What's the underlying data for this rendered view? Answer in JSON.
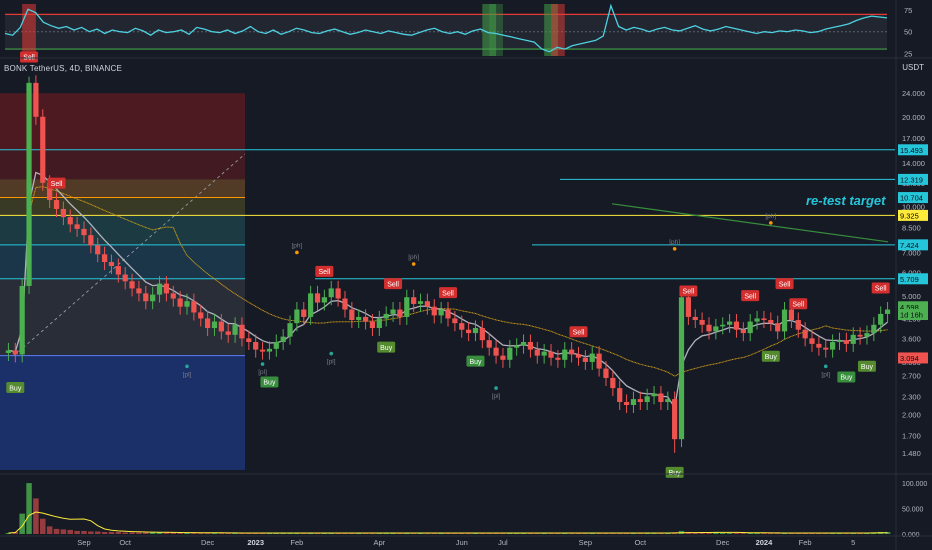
{
  "symbol_header": "BONK TetherUS, 4D, BINANCE",
  "currency": "USDT",
  "annotation": "re-test target",
  "colors": {
    "bg": "#161a25",
    "up": "#26a69a",
    "up_candle": "#4caf50",
    "down": "#ef5350",
    "ema": "#b0b3bd",
    "ma": "#d4a017",
    "cyan": "#26c6da",
    "yellow": "#ffeb3b",
    "orange": "#ff9800",
    "green_line": "#388e3c",
    "sell": "#d32f2f",
    "buy": "#388e3c",
    "buy_olive": "#558b2f",
    "rsi": "#4dd0e1",
    "label_blue": "#26c6da"
  },
  "chart_data": [
    {
      "type": "line",
      "name": "oscillator",
      "y_ticks": [
        75,
        50,
        25
      ],
      "ylim": [
        22,
        82
      ],
      "y": [
        48,
        46,
        55,
        76,
        72,
        61,
        57,
        54,
        56,
        52,
        55,
        50,
        53,
        48,
        52,
        50,
        49,
        54,
        51,
        46,
        52,
        49,
        50,
        52,
        47,
        55,
        53,
        50,
        49,
        52,
        48,
        51,
        56,
        50,
        48,
        52,
        47,
        50,
        54,
        52,
        49,
        48,
        51,
        53,
        50,
        47,
        49,
        52,
        50,
        48,
        51,
        49,
        47,
        46,
        49,
        52,
        54,
        50,
        48,
        50,
        47,
        51,
        53,
        49,
        48,
        46,
        44,
        42,
        40,
        38,
        30,
        27,
        32,
        30,
        34,
        36,
        38,
        40,
        45,
        80,
        56,
        52,
        55,
        53,
        50,
        53,
        55,
        52,
        51,
        54,
        57,
        53,
        51,
        53,
        56,
        54,
        52,
        50,
        48,
        50,
        49,
        51,
        50,
        52,
        51,
        49,
        50,
        53,
        55,
        57,
        59,
        63,
        66,
        68,
        67,
        66
      ]
    },
    {
      "type": "candlestick",
      "name": "price",
      "y_scale": "log",
      "y_ticks": [
        24.0,
        20.0,
        17.0,
        14.0,
        12.0,
        10.0,
        8.5,
        7.0,
        6.0,
        5.0,
        4.2,
        3.6,
        3.0,
        2.7,
        2.3,
        2.0,
        1.7,
        1.48
      ],
      "ylim": [
        1.3,
        27.0
      ],
      "x_labels": [
        "Sep",
        "Oct",
        "Dec",
        "2023",
        "Feb",
        "Apr",
        "Jun",
        "Jul",
        "Sep",
        "Oct",
        "Dec",
        "2024",
        "Feb",
        "5"
      ],
      "close": [
        3.28,
        3.18,
        5.4,
        26.0,
        20.0,
        12.0,
        10.5,
        9.8,
        9.2,
        8.7,
        8.4,
        8.0,
        7.4,
        6.9,
        6.5,
        6.3,
        5.9,
        5.6,
        5.3,
        5.1,
        4.8,
        5.05,
        5.5,
        5.1,
        4.9,
        4.6,
        4.8,
        4.4,
        4.2,
        3.9,
        4.1,
        3.8,
        3.7,
        4.0,
        3.6,
        3.5,
        3.3,
        3.25,
        3.32,
        3.5,
        3.65,
        4.05,
        4.5,
        4.25,
        5.1,
        4.75,
        4.95,
        5.3,
        4.9,
        4.5,
        4.15,
        4.25,
        4.1,
        3.9,
        4.2,
        4.35,
        4.5,
        4.25,
        4.95,
        4.7,
        4.8,
        4.6,
        4.3,
        4.5,
        4.2,
        4.05,
        3.85,
        3.75,
        3.9,
        3.55,
        3.35,
        3.15,
        3.05,
        3.35,
        3.4,
        3.5,
        3.3,
        3.15,
        3.25,
        3.1,
        3.05,
        3.3,
        3.18,
        3.1,
        3.0,
        3.2,
        2.85,
        2.65,
        2.45,
        2.2,
        2.15,
        2.25,
        2.2,
        2.3,
        2.35,
        2.2,
        2.25,
        1.65,
        4.95,
        4.25,
        4.15,
        4.0,
        3.8,
        3.95,
        4.0,
        4.1,
        3.85,
        3.75,
        4.1,
        4.2,
        4.15,
        4.05,
        3.8,
        4.5,
        4.15,
        3.85,
        3.6,
        3.45,
        3.35,
        3.3,
        3.5,
        3.55,
        3.45,
        3.7,
        3.65,
        3.75,
        4.0,
        4.35,
        4.5
      ]
    },
    {
      "type": "area",
      "name": "volume",
      "y_ticks": [
        "100.000",
        "50.000",
        "0.000"
      ],
      "ylim": [
        0,
        110
      ],
      "y": [
        2,
        4,
        40,
        100,
        70,
        30,
        15,
        10,
        9,
        8,
        6,
        6,
        5,
        5,
        4,
        4,
        4,
        3,
        3,
        3,
        3,
        3,
        3,
        3,
        3,
        2,
        2,
        2,
        2,
        2,
        2,
        2,
        2,
        2,
        2,
        2,
        2,
        2,
        2,
        2,
        2,
        2,
        2,
        2,
        2,
        2,
        2,
        2,
        2,
        2,
        2,
        2,
        2,
        2,
        2,
        2,
        2,
        2,
        2,
        2,
        2,
        2,
        2,
        2,
        2,
        2,
        2,
        2,
        2,
        2,
        2,
        2,
        2,
        2,
        2,
        2,
        2,
        2,
        2,
        2,
        2,
        2,
        2,
        2,
        2,
        2,
        2,
        2,
        2,
        2,
        2,
        2,
        2,
        2,
        2,
        2,
        2,
        3,
        6,
        4,
        3,
        3,
        3,
        3,
        2,
        2,
        2,
        2,
        2,
        2,
        2,
        2,
        2,
        2,
        2,
        2,
        2,
        2,
        2,
        2,
        2,
        2,
        2,
        2,
        2,
        2,
        3,
        4,
        4
      ]
    }
  ],
  "price_labels": [
    {
      "text": "15.493",
      "color": "#26c6da",
      "value": 15.493
    },
    {
      "text": "12.319",
      "color": "#26c6da",
      "value": 12.319
    },
    {
      "text": "10.704",
      "color": "#26c6da",
      "value": 10.704
    },
    {
      "text": "9.325",
      "color": "#ffeb3b",
      "value": 9.325
    },
    {
      "text": "7.424",
      "color": "#26c6da",
      "value": 7.424
    },
    {
      "text": "5.709",
      "color": "#26c6da",
      "value": 5.709
    },
    {
      "text": "4.598",
      "color": "#4caf50",
      "value": 4.598
    },
    {
      "text": "1d 16h",
      "color": "#4caf50",
      "value": 4.33
    },
    {
      "text": "3.094",
      "color": "#ef5350",
      "value": 3.094
    }
  ],
  "signals": [
    {
      "text": "Sell",
      "kind": "sell",
      "index": 3
    },
    {
      "text": "Sell",
      "kind": "sell",
      "index": 7
    },
    {
      "text": "Buy",
      "kind": "buy",
      "index": 1
    },
    {
      "text": "Buy",
      "kind": "buy",
      "index": 38
    },
    {
      "text": "Sell",
      "kind": "sell",
      "index": 46
    },
    {
      "text": "Sell",
      "kind": "sell",
      "index": 56
    },
    {
      "text": "Buy",
      "kind": "buy",
      "index": 55
    },
    {
      "text": "Sell",
      "kind": "sell",
      "index": 64
    },
    {
      "text": "Buy",
      "kind": "buy",
      "index": 68
    },
    {
      "text": "Sell",
      "kind": "sell",
      "index": 83
    },
    {
      "text": "Sell",
      "kind": "sell",
      "index": 99
    },
    {
      "text": "Buy",
      "kind": "buy",
      "index": 97
    },
    {
      "text": "Sell",
      "kind": "sell",
      "index": 108
    },
    {
      "text": "Sell",
      "kind": "sell",
      "index": 113
    },
    {
      "text": "Sell",
      "kind": "sell",
      "index": 115
    },
    {
      "text": "Buy",
      "kind": "buy",
      "index": 111
    },
    {
      "text": "Buy",
      "kind": "buy",
      "index": 122
    },
    {
      "text": "Buy",
      "kind": "buy",
      "index": 125
    },
    {
      "text": "Sell",
      "kind": "sell",
      "index": 127
    }
  ],
  "pivots": [
    {
      "text": "[ph]",
      "index": 42,
      "value": 7.0
    },
    {
      "text": "[ph]",
      "index": 59,
      "value": 6.4
    },
    {
      "text": "[pl]",
      "index": 47,
      "value": 3.2
    },
    {
      "text": "[pl]",
      "index": 37,
      "value": 2.95
    },
    {
      "text": "[pl]",
      "index": 26,
      "value": 2.9
    },
    {
      "text": "[pl]",
      "index": 71,
      "value": 2.45
    },
    {
      "text": "[ph]",
      "index": 97,
      "value": 7.2
    },
    {
      "text": "[ph]",
      "index": 111,
      "value": 8.8
    },
    {
      "text": "[pl]",
      "index": 119,
      "value": 2.9
    }
  ]
}
